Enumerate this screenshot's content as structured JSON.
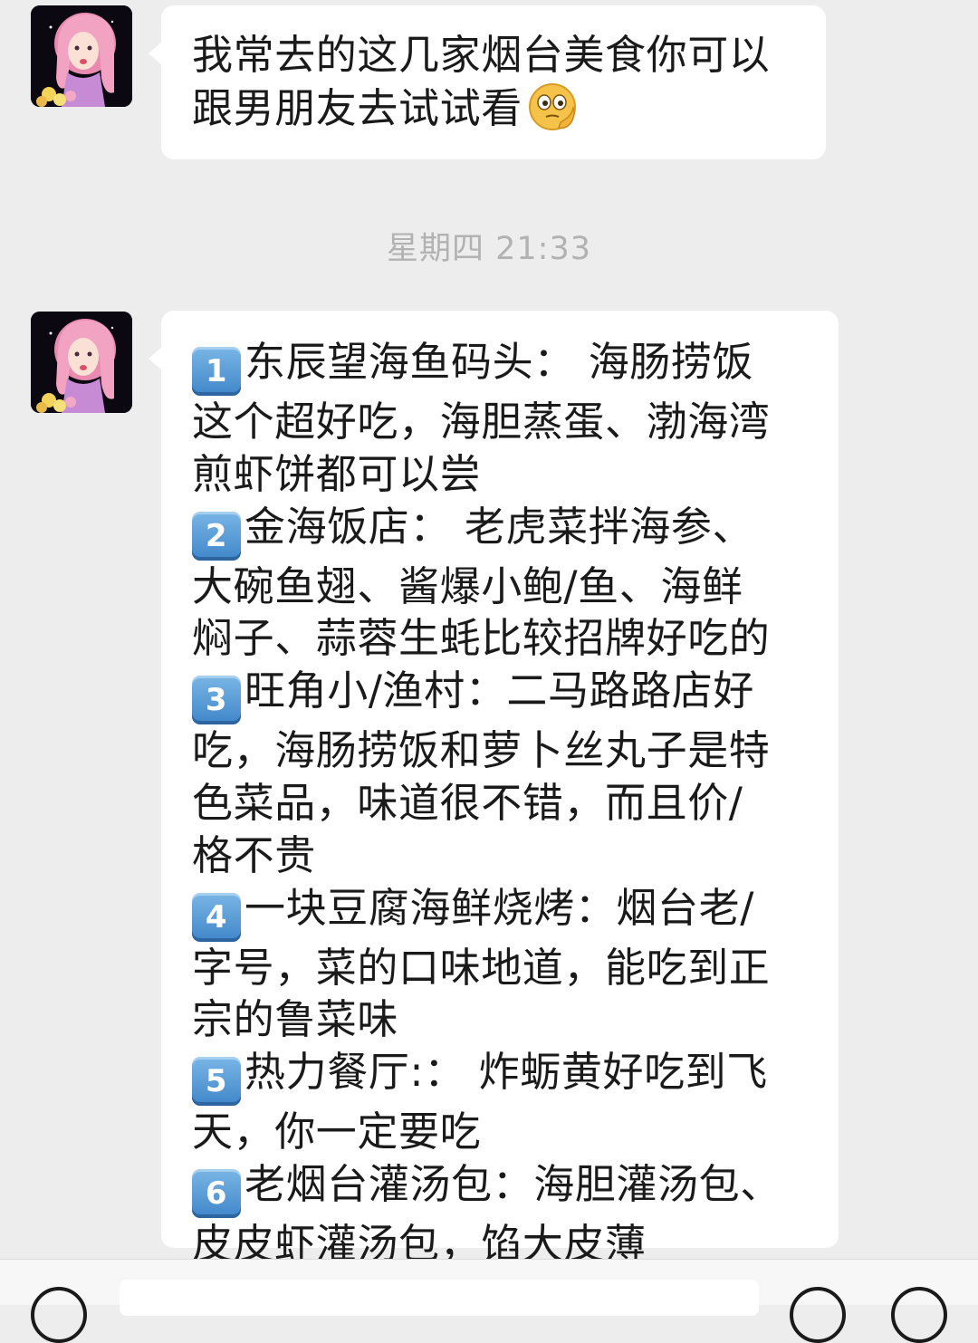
{
  "messages": [
    {
      "sender": "contact",
      "lines": [
        "我常去的这几家烟台美食你可以",
        "跟男朋友去试试看"
      ],
      "emoji": "thinking-face-emoji"
    },
    {
      "sender": "contact",
      "lines": [
        {
          "key": "1",
          "text": "东辰望海鱼码头： 海肠捞饭"
        },
        {
          "text": "这个超好吃，海胆蒸蛋、渤海湾"
        },
        {
          "text": "煎虾饼都可以尝"
        },
        {
          "key": "2",
          "text": "金海饭店： 老虎菜拌海参、"
        },
        {
          "text": "大碗鱼翅、酱爆小鲍/鱼、海鲜"
        },
        {
          "text": "焖子、蒜蓉生蚝比较招牌好吃的"
        },
        {
          "key": "3",
          "text": "旺角小/渔村：二马路路店好"
        },
        {
          "text": "吃，海肠捞饭和萝卜丝丸子是特"
        },
        {
          "text": "色菜品，味道很不错，而且价/"
        },
        {
          "text": "格不贵"
        },
        {
          "key": "4",
          "text": "一块豆腐海鲜烧烤：烟台老/"
        },
        {
          "text": "字号，菜的口味地道，能吃到正"
        },
        {
          "text": "宗的鲁菜味"
        },
        {
          "key": "5",
          "text": "热力餐厅:： 炸蛎黄好吃到飞"
        },
        {
          "text": "天，你一定要吃"
        },
        {
          "key": "6",
          "text": "老烟台灌汤包：海胆灌汤包、"
        },
        {
          "text": "皮皮虾灌汤包，馅大皮薄"
        }
      ]
    }
  ],
  "timestamp": "星期四 21:33",
  "colors": {
    "background": "#ededed",
    "bubble": "#ffffff",
    "text": "#1a1a1a",
    "timestamp": "#b2b2b2",
    "keycap": "#4a90d2"
  },
  "icons": {
    "avatar": "pink-haired-girl-avatar",
    "voice_button": "voice-icon",
    "emoji_button": "emoji-icon",
    "more_button": "plus-icon"
  }
}
